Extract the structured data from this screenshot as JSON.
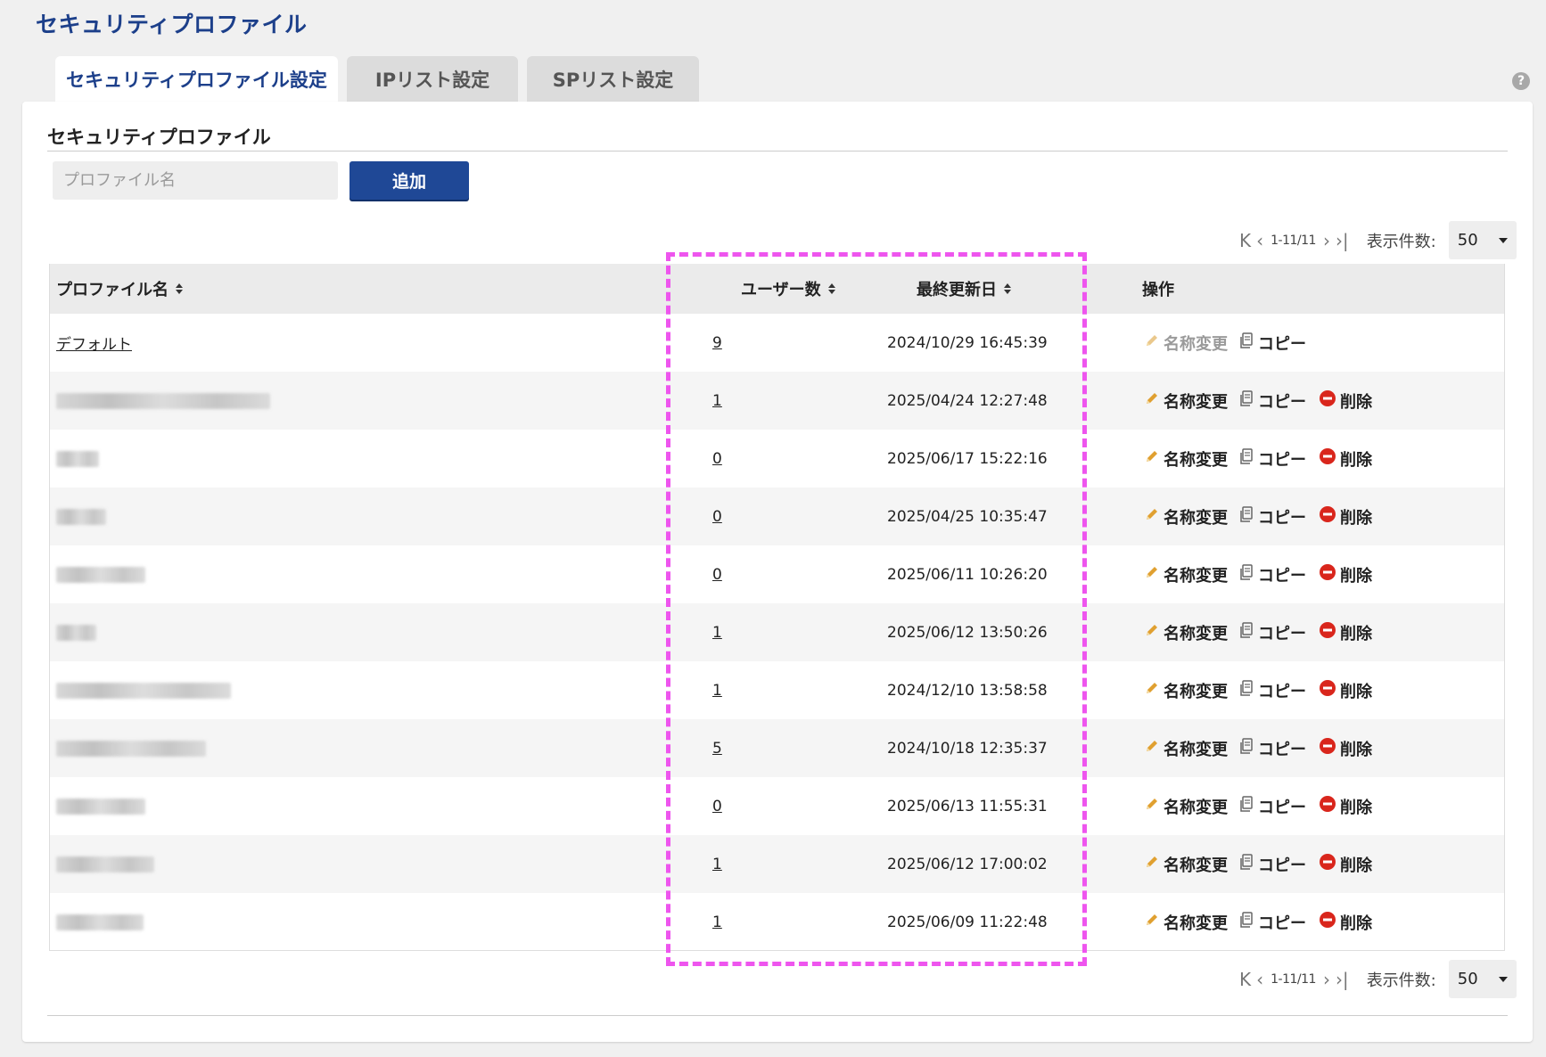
{
  "page": {
    "title": "セキュリティプロファイル",
    "help_icon": "help-icon"
  },
  "tabs": [
    {
      "label": "セキュリティプロファイル設定",
      "active": true
    },
    {
      "label": "IPリスト設定",
      "active": false
    },
    {
      "label": "SPリスト設定",
      "active": false
    }
  ],
  "section": {
    "title": "セキュリティプロファイル",
    "input_placeholder": "プロファイル名",
    "add_label": "追加"
  },
  "pager": {
    "first_icon": "first-page-icon",
    "prev_icon": "prev-page-icon",
    "next_icon": "next-page-icon",
    "last_icon": "last-page-icon",
    "range": "1-11/11",
    "per_page_label": "表示件数:",
    "per_page_value": "50"
  },
  "table": {
    "columns": {
      "name": "プロファイル名",
      "users": "ユーザー数",
      "updated": "最終更新日",
      "ops": "操作"
    },
    "actions": {
      "rename": "名称変更",
      "copy": "コピー",
      "delete": "削除"
    },
    "rows": [
      {
        "name": "デフォルト",
        "blurred": false,
        "users": "9",
        "updated": "2024/10/29 16:45:39",
        "rename_disabled": true,
        "deletable": false
      },
      {
        "name": "",
        "blurred": true,
        "users": "1",
        "updated": "2025/04/24 12:27:48",
        "rename_disabled": false,
        "deletable": true
      },
      {
        "name": "",
        "blurred": true,
        "users": "0",
        "updated": "2025/06/17 15:22:16",
        "rename_disabled": false,
        "deletable": true
      },
      {
        "name": "",
        "blurred": true,
        "users": "0",
        "updated": "2025/04/25 10:35:47",
        "rename_disabled": false,
        "deletable": true
      },
      {
        "name": "",
        "blurred": true,
        "users": "0",
        "updated": "2025/06/11 10:26:20",
        "rename_disabled": false,
        "deletable": true
      },
      {
        "name": "",
        "blurred": true,
        "users": "1",
        "updated": "2025/06/12 13:50:26",
        "rename_disabled": false,
        "deletable": true
      },
      {
        "name": "",
        "blurred": true,
        "users": "1",
        "updated": "2024/12/10 13:58:58",
        "rename_disabled": false,
        "deletable": true
      },
      {
        "name": "",
        "blurred": true,
        "users": "5",
        "updated": "2024/10/18 12:35:37",
        "rename_disabled": false,
        "deletable": true
      },
      {
        "name": "",
        "blurred": true,
        "users": "0",
        "updated": "2025/06/13 11:55:31",
        "rename_disabled": false,
        "deletable": true
      },
      {
        "name": "",
        "blurred": true,
        "users": "1",
        "updated": "2025/06/12 17:00:02",
        "rename_disabled": false,
        "deletable": true
      },
      {
        "name": "",
        "blurred": true,
        "users": "1",
        "updated": "2025/06/09 11:22:48",
        "rename_disabled": false,
        "deletable": true
      }
    ]
  },
  "colors": {
    "brand": "#1c3f8a",
    "button": "#1f4896",
    "highlight": "#ee55ee",
    "delete": "#d9261c",
    "pencil": "#e0a030"
  }
}
